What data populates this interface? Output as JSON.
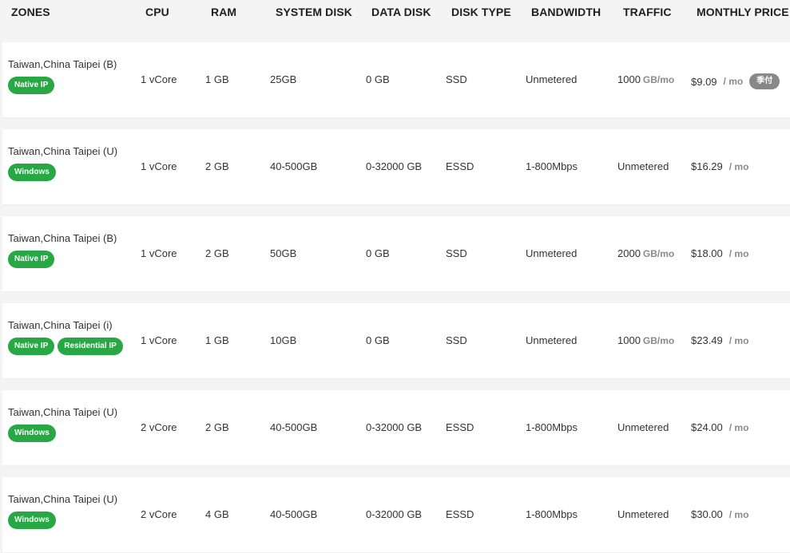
{
  "headers": {
    "zones": "ZONES",
    "cpu": "CPU",
    "ram": "RAM",
    "system_disk": "SYSTEM DISK",
    "data_disk": "DATA DISK",
    "disk_type": "DISK TYPE",
    "bandwidth": "BANDWIDTH",
    "traffic": "TRAFFIC",
    "monthly_price": "MONTHLY PRICE"
  },
  "colors": {
    "tag_green": "#28a745",
    "badge_gray": "#888888"
  },
  "rows": [
    {
      "zone": "Taiwan,China Taipei (B)",
      "tags": [
        "Native IP"
      ],
      "cpu": "1 vCore",
      "ram": "1 GB",
      "system_disk": "25GB",
      "data_disk": "0 GB",
      "disk_type": "SSD",
      "bandwidth": "Unmetered",
      "traffic": "1000",
      "traffic_unit": "GB/mo",
      "price": "$9.09",
      "price_unit": "/ mo",
      "badge": "季付"
    },
    {
      "zone": "Taiwan,China Taipei (U)",
      "tags": [
        "Windows"
      ],
      "cpu": "1 vCore",
      "ram": "2 GB",
      "system_disk": "40-500GB",
      "data_disk": "0-32000 GB",
      "disk_type": "ESSD",
      "bandwidth": "1-800Mbps",
      "traffic": "Unmetered",
      "traffic_unit": "",
      "price": "$16.29",
      "price_unit": "/ mo",
      "badge": ""
    },
    {
      "zone": "Taiwan,China Taipei (B)",
      "tags": [
        "Native IP"
      ],
      "cpu": "1 vCore",
      "ram": "2 GB",
      "system_disk": "50GB",
      "data_disk": "0 GB",
      "disk_type": "SSD",
      "bandwidth": "Unmetered",
      "traffic": "2000",
      "traffic_unit": "GB/mo",
      "price": "$18.00",
      "price_unit": "/ mo",
      "badge": ""
    },
    {
      "zone": "Taiwan,China Taipei (i)",
      "tags": [
        "Native IP",
        "Residential IP"
      ],
      "cpu": "1 vCore",
      "ram": "1 GB",
      "system_disk": "10GB",
      "data_disk": "0 GB",
      "disk_type": "SSD",
      "bandwidth": "Unmetered",
      "traffic": "1000",
      "traffic_unit": "GB/mo",
      "price": "$23.49",
      "price_unit": "/ mo",
      "badge": ""
    },
    {
      "zone": "Taiwan,China Taipei (U)",
      "tags": [
        "Windows"
      ],
      "cpu": "2 vCore",
      "ram": "2 GB",
      "system_disk": "40-500GB",
      "data_disk": "0-32000 GB",
      "disk_type": "ESSD",
      "bandwidth": "1-800Mbps",
      "traffic": "Unmetered",
      "traffic_unit": "",
      "price": "$24.00",
      "price_unit": "/ mo",
      "badge": ""
    },
    {
      "zone": "Taiwan,China Taipei (U)",
      "tags": [
        "Windows"
      ],
      "cpu": "2 vCore",
      "ram": "4 GB",
      "system_disk": "40-500GB",
      "data_disk": "0-32000 GB",
      "disk_type": "ESSD",
      "bandwidth": "1-800Mbps",
      "traffic": "Unmetered",
      "traffic_unit": "",
      "price": "$30.00",
      "price_unit": "/ mo",
      "badge": ""
    }
  ]
}
